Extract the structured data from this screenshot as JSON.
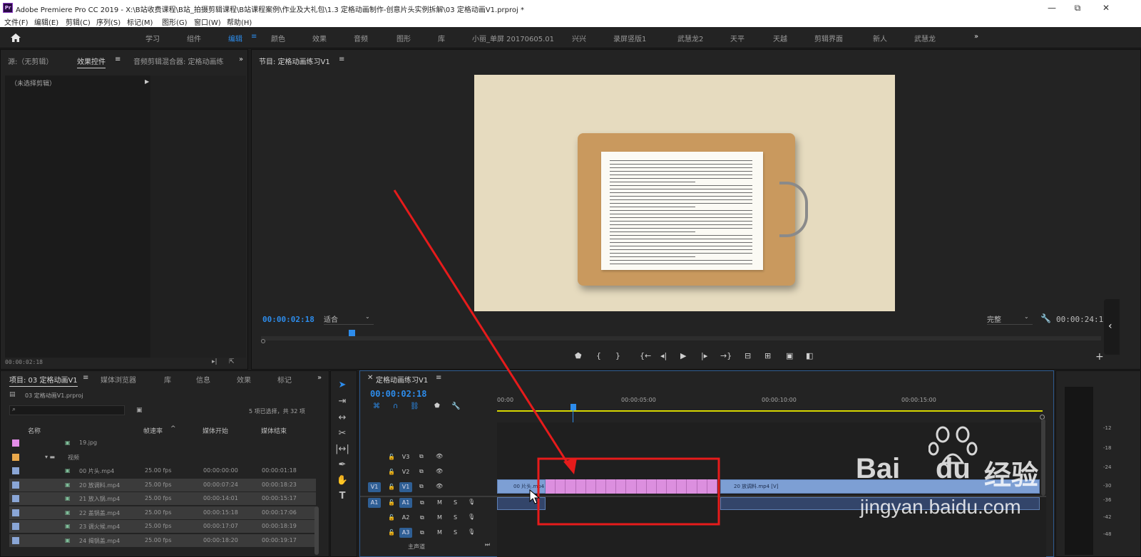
{
  "window": {
    "logo": "Pr",
    "title": "Adobe Premiere Pro CC 2019 - X:\\B站收费课程\\B站_拍摄剪辑课程\\B站课程案例\\作业及大礼包\\1.3 定格动画制作-创意片头实例拆解\\03 定格动画V1.prproj *",
    "minimize": "—",
    "restore": "⧉",
    "close": "✕"
  },
  "menu": [
    "文件(F)",
    "编辑(E)",
    "剪辑(C)",
    "序列(S)",
    "标记(M)",
    "图形(G)",
    "窗口(W)",
    "帮助(H)"
  ],
  "workspaces": [
    "学习",
    "组件",
    "编辑",
    "颜色",
    "效果",
    "音频",
    "图形",
    "库",
    "小丽_单屏 20170605.01",
    "兴兴",
    "录屏竖版1",
    "武慧龙2",
    "天平",
    "天越",
    "剪辑界面",
    "新人",
    "武慧龙"
  ],
  "workspace_active": "编辑",
  "workspace_more": "»",
  "source_panel": {
    "tabs": [
      "源:（无剪辑）",
      "效果控件",
      "音频剪辑混合器: 定格动画练"
    ],
    "active_tab": "效果控件",
    "more": "»",
    "no_clip": "（未选择剪辑）",
    "timecode": "00:00:02:18"
  },
  "program": {
    "title": "节目: 定格动画练习V1",
    "timecode": "00:00:02:18",
    "fit": "适合",
    "quality": "完整",
    "duration": "00:00:24:13"
  },
  "project": {
    "tabs": [
      "项目: 03 定格动画V1",
      "媒体浏览器",
      "库",
      "信息",
      "效果",
      "标记"
    ],
    "more": "»",
    "file": "03 定格动画V1.prproj",
    "selection": "5 项已选择，共 32 项",
    "columns": [
      "名称",
      "帧速率",
      "媒体开始",
      "媒体结束"
    ],
    "rows": [
      {
        "name": "19.jpg",
        "fps": "",
        "start": "",
        "end": "",
        "color": "#e38de8",
        "selected": false,
        "indent": 1
      },
      {
        "name": "视频",
        "fps": "",
        "start": "",
        "end": "",
        "color": "#e9a84b",
        "selected": false,
        "indent": 0
      },
      {
        "name": "00 片头.mp4",
        "fps": "25.00 fps",
        "start": "00:00:00:00",
        "end": "00:00:01:18",
        "color": "#8aa6d6",
        "selected": false,
        "indent": 1
      },
      {
        "name": "20 放调料.mp4",
        "fps": "25.00 fps",
        "start": "00:00:07:24",
        "end": "00:00:18:23",
        "color": "#8aa6d6",
        "selected": true,
        "indent": 1
      },
      {
        "name": "21 放入锅.mp4",
        "fps": "25.00 fps",
        "start": "00:00:14:01",
        "end": "00:00:15:17",
        "color": "#8aa6d6",
        "selected": true,
        "indent": 1
      },
      {
        "name": "22 盖锅盖.mp4",
        "fps": "25.00 fps",
        "start": "00:00:15:18",
        "end": "00:00:17:06",
        "color": "#8aa6d6",
        "selected": true,
        "indent": 1
      },
      {
        "name": "23 调火候.mp4",
        "fps": "25.00 fps",
        "start": "00:00:17:07",
        "end": "00:00:18:19",
        "color": "#8aa6d6",
        "selected": true,
        "indent": 1
      },
      {
        "name": "24 揭锅盖.mp4",
        "fps": "25.00 fps",
        "start": "00:00:18:20",
        "end": "00:00:19:17",
        "color": "#8aa6d6",
        "selected": true,
        "indent": 1
      }
    ]
  },
  "timeline": {
    "title": "定格动画练习V1",
    "timecode": "00:00:02:18",
    "ruler": [
      "00:00",
      "00:00:05:00",
      "00:00:10:00",
      "00:00:15:00"
    ],
    "tracks": [
      "V3",
      "V2",
      "V1",
      "A1",
      "A2",
      "A3"
    ],
    "source_v": "V1",
    "source_a": "A1",
    "clip1": "00 片头.mp4",
    "clip2": "20 放调料.mp4 [V]",
    "pink_segments": 17,
    "audio_master": "主声道"
  },
  "meter": [
    "-12",
    "-18",
    "-24",
    "-30",
    "-36",
    "-42",
    "-48"
  ],
  "watermark": {
    "brand": "Bai",
    "brand2": "du",
    "cn": "经验",
    "url": "jingyan.baidu.com"
  },
  "colors": {
    "accent": "#2d8ceb",
    "clip_blue": "#7d9fd4",
    "clip_pink": "#dc8fdf",
    "annotation": "#e61b1b",
    "work_area": "#d7d700"
  }
}
